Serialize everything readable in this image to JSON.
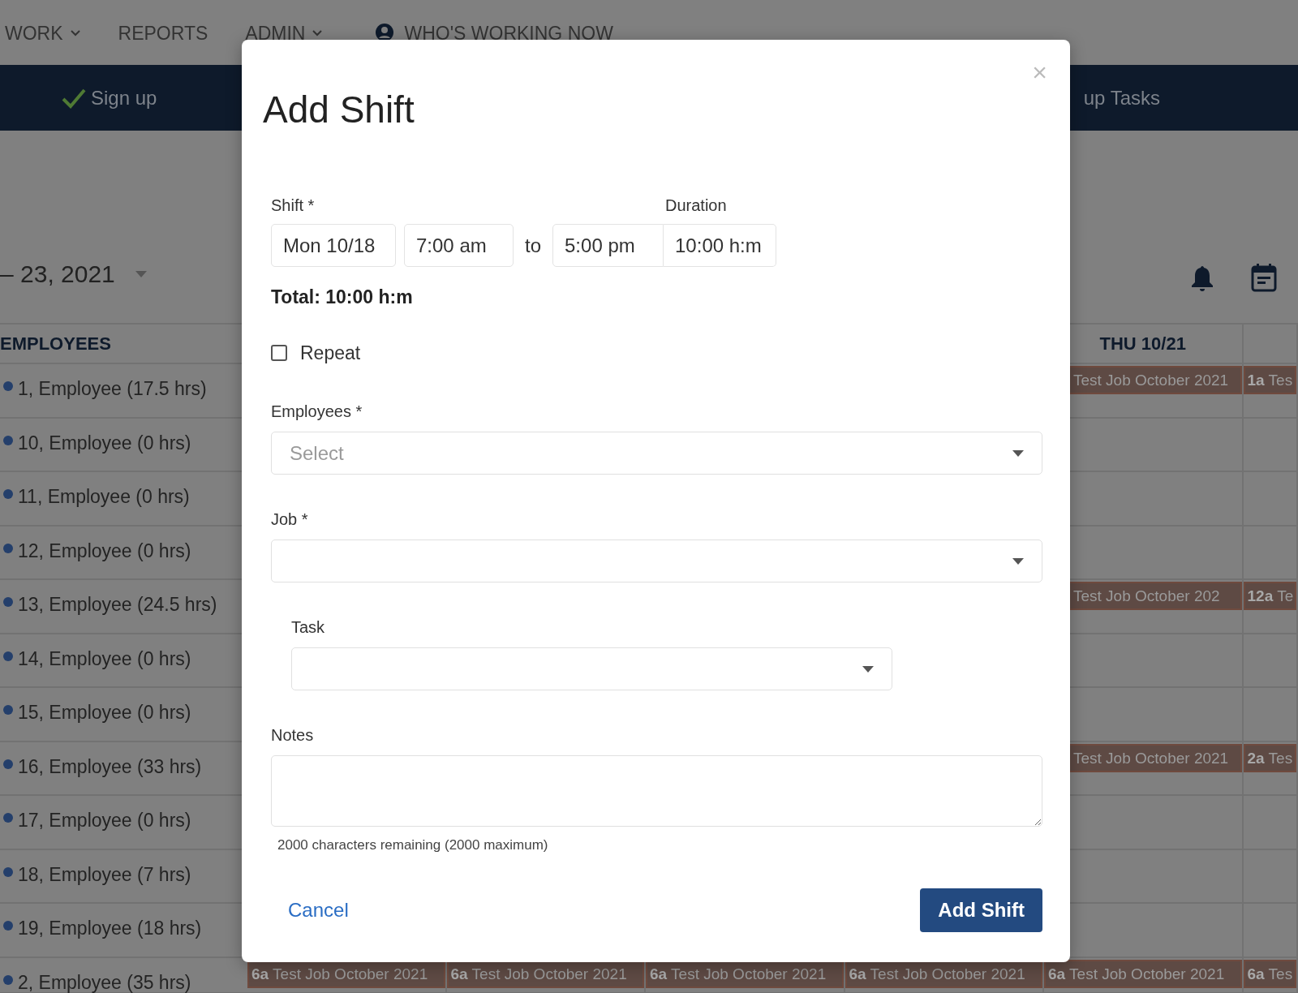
{
  "nav": {
    "items": [
      {
        "label": "WORK",
        "kind": "dropdown"
      },
      {
        "label": "REPORTS",
        "kind": "plain"
      },
      {
        "label": "ADMIN",
        "kind": "dropdown"
      },
      {
        "label": "WHO'S WORKING NOW",
        "kind": "person"
      }
    ]
  },
  "band": {
    "items": [
      {
        "label": "Sign up",
        "checked": true
      },
      {
        "label": "up Tasks",
        "checked": false
      }
    ]
  },
  "date_range": {
    "label": "– 23, 2021"
  },
  "schedule": {
    "employees_header": "EMPLOYEES",
    "day_headers": [
      {
        "kind": "empty"
      },
      {
        "kind": "empty"
      },
      {
        "kind": "empty"
      },
      {
        "kind": "empty"
      },
      {
        "kind": "label",
        "text": "THU 10/21"
      },
      {
        "kind": "empty"
      }
    ],
    "rows": [
      {
        "name": "1, Employee (17.5 hrs)",
        "shifts": [
          {
            "kind": "empty"
          },
          {
            "kind": "empty"
          },
          {
            "kind": "empty"
          },
          {
            "kind": "empty"
          },
          {
            "kind": "shift",
            "job": "Test Job October 2021"
          },
          {
            "kind": "shift",
            "time": "1a",
            "job": "Tes"
          }
        ]
      },
      {
        "name": "10, Employee (0 hrs)"
      },
      {
        "name": "11, Employee (0 hrs)"
      },
      {
        "name": "12, Employee (0 hrs)"
      },
      {
        "name": "13, Employee (24.5 hrs)",
        "shifts": [
          {
            "kind": "empty"
          },
          {
            "kind": "empty"
          },
          {
            "kind": "empty"
          },
          {
            "kind": "empty"
          },
          {
            "kind": "shift",
            "job": "Test Job October 202"
          },
          {
            "kind": "shift",
            "time": "12a",
            "job": "Te"
          }
        ]
      },
      {
        "name": "14, Employee (0 hrs)"
      },
      {
        "name": "15, Employee (0 hrs)"
      },
      {
        "name": "16, Employee (33 hrs)",
        "shifts": [
          {
            "kind": "empty"
          },
          {
            "kind": "empty"
          },
          {
            "kind": "empty"
          },
          {
            "kind": "empty"
          },
          {
            "kind": "shift",
            "job": "Test Job October 2021"
          },
          {
            "kind": "shift",
            "time": "2a",
            "job": "Tes"
          }
        ]
      },
      {
        "name": "17, Employee (0 hrs)"
      },
      {
        "name": "18, Employee (7 hrs)"
      },
      {
        "name": "19, Employee (18 hrs)"
      },
      {
        "name": "2, Employee (35 hrs)",
        "shifts": [
          {
            "kind": "shift",
            "time": "6a",
            "job": "Test Job October 2021"
          },
          {
            "kind": "shift",
            "time": "6a",
            "job": "Test Job October 2021"
          },
          {
            "kind": "shift",
            "time": "6a",
            "job": "Test Job October 2021"
          },
          {
            "kind": "shift",
            "time": "6a",
            "job": "Test Job October 2021"
          },
          {
            "kind": "shift",
            "time": "6a",
            "job": "Test Job October 2021"
          },
          {
            "kind": "shift",
            "time": "6a",
            "job": "Tes"
          }
        ]
      }
    ]
  },
  "modal": {
    "title": "Add Shift",
    "close": "×",
    "shift": {
      "label": "Shift *",
      "date": "Mon 10/18",
      "start": "7:00 am",
      "to": "to",
      "end": "5:00 pm",
      "duration_label": "Duration",
      "duration": "10:00 h:m"
    },
    "total": "Total: 10:00 h:m",
    "repeat": {
      "label": "Repeat",
      "checked": false
    },
    "employees": {
      "label": "Employees *",
      "placeholder": "Select"
    },
    "job": {
      "label": "Job *"
    },
    "task": {
      "label": "Task"
    },
    "notes": {
      "label": "Notes",
      "helper": "2000 characters remaining (2000 maximum)"
    },
    "cancel": "Cancel",
    "submit": "Add Shift"
  }
}
